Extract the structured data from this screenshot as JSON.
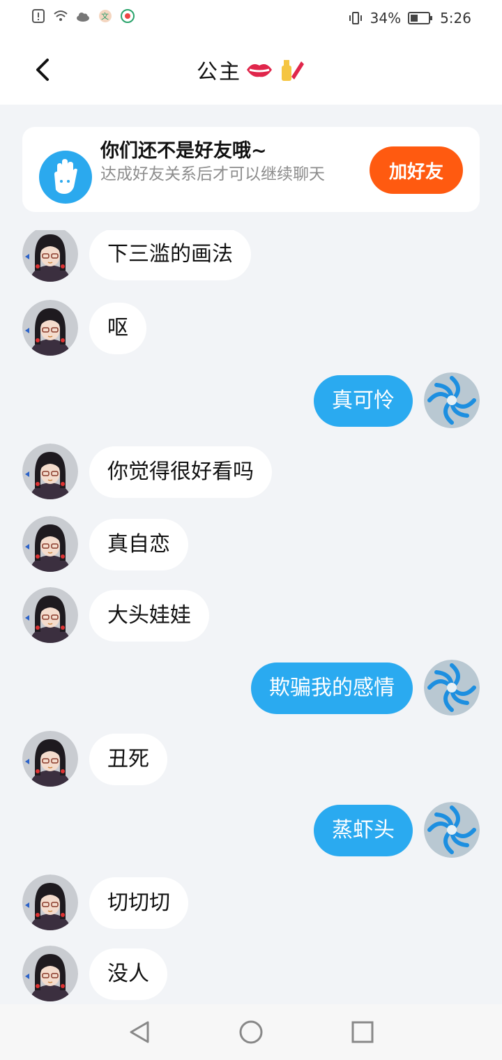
{
  "status_bar": {
    "battery": "34%",
    "time": "5:26"
  },
  "header": {
    "title": "公主"
  },
  "friend_notice": {
    "title": "你们还不是好友哦~",
    "subtitle": "达成好友关系后才可以继续聊天",
    "button_label": "加好友"
  },
  "messages": [
    {
      "side": "left",
      "text": "下三滥的画法"
    },
    {
      "side": "left",
      "text": "呕"
    },
    {
      "side": "right",
      "text": "真可怜"
    },
    {
      "side": "left",
      "text": "你觉得很好看吗"
    },
    {
      "side": "left",
      "text": "真自恋"
    },
    {
      "side": "left",
      "text": "大头娃娃"
    },
    {
      "side": "right",
      "text": "欺骗我的感情"
    },
    {
      "side": "left",
      "text": "丑死"
    },
    {
      "side": "right",
      "text": "蒸虾头"
    },
    {
      "side": "left",
      "text": "切切切"
    },
    {
      "side": "left",
      "text": "没人"
    }
  ],
  "colors": {
    "accent": "#2aaaf0",
    "add_friend": "#ff5a10",
    "background": "#f2f4f7"
  },
  "icons": {
    "back": "back-arrow-icon",
    "lips": "lips-emoji-icon",
    "nail_polish": "nail-polish-emoji-icon",
    "wave": "waving-hand-icon",
    "nav_back": "triangle-back-icon",
    "nav_home": "circle-home-icon",
    "nav_recent": "square-recent-icon"
  }
}
